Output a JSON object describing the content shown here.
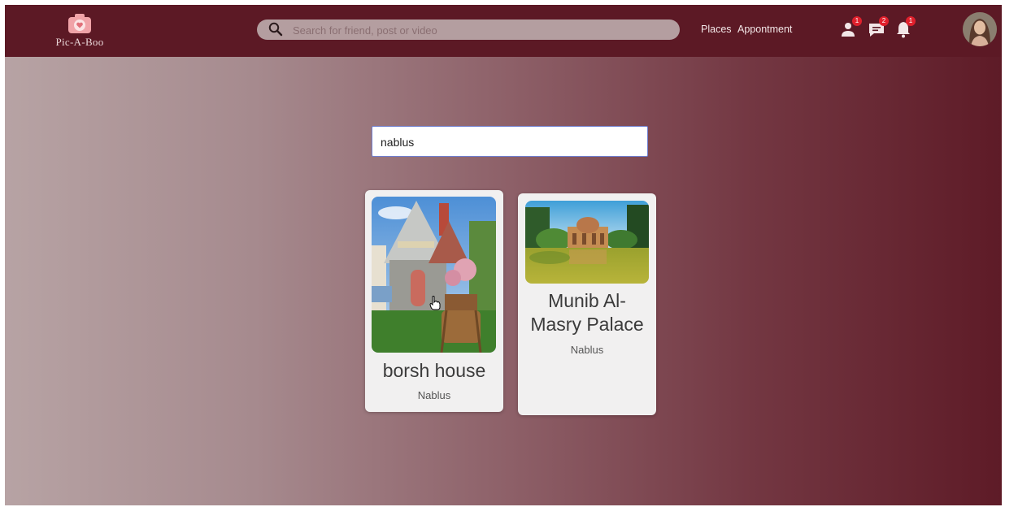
{
  "app": {
    "name": "Pic-A-Boo"
  },
  "header": {
    "search_placeholder": "Search for friend, post or video",
    "nav": [
      {
        "label": "Places"
      },
      {
        "label": "Appontment"
      }
    ],
    "notifications": [
      {
        "icon": "friend-request-icon",
        "count": "1"
      },
      {
        "icon": "message-icon",
        "count": "2"
      },
      {
        "icon": "bell-icon",
        "count": "1"
      }
    ],
    "avatar_icon": "user-avatar"
  },
  "place_search": {
    "value": "nablus"
  },
  "results": [
    {
      "name": "borsh house",
      "city": "Nablus",
      "image": "house-photo"
    },
    {
      "name": "Munib Al-Masry Palace",
      "city": "Nablus",
      "image": "palace-photo"
    }
  ],
  "colors": {
    "header_bg": "#5c1925",
    "gradient_start": "#b7a3a4",
    "gradient_end": "#5e1b27",
    "badge": "#e0202c",
    "logo_pink": "#f0a3a8"
  }
}
